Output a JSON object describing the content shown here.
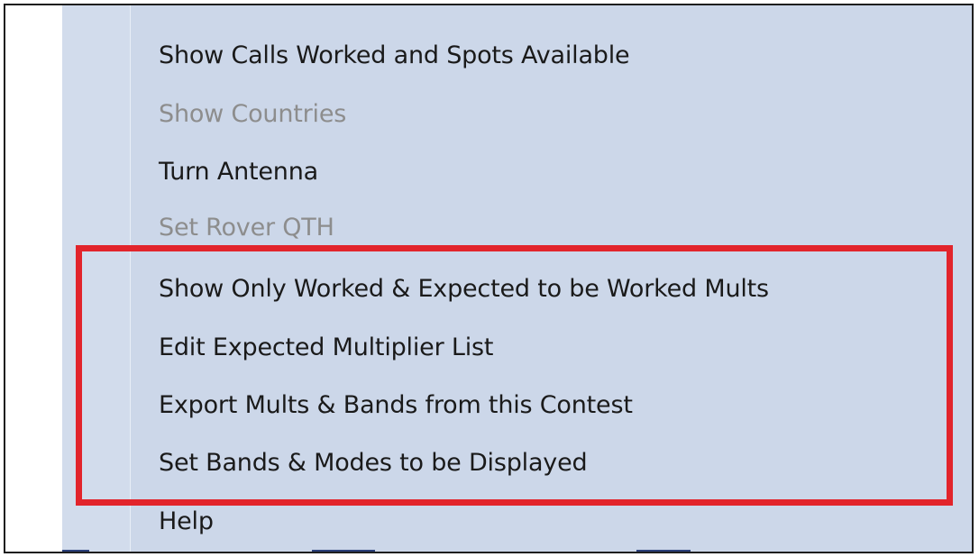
{
  "context_menu": {
    "items": [
      {
        "label": "Show Calls Worked and Spots Available",
        "enabled": true
      },
      {
        "label": "Show Countries",
        "enabled": false
      },
      {
        "label": "Turn Antenna",
        "enabled": true
      },
      {
        "label": "Set Rover QTH",
        "enabled": false
      },
      {
        "label": "Show Only Worked & Expected to be Worked Mults",
        "enabled": true
      },
      {
        "label": "Edit Expected Multiplier List",
        "enabled": true
      },
      {
        "label": "Export Mults & Bands from this Contest",
        "enabled": true
      },
      {
        "label": "Set Bands & Modes to be Displayed",
        "enabled": true
      },
      {
        "label": "Help",
        "enabled": true
      }
    ]
  },
  "colors": {
    "menu_background": "#ccd7e9",
    "highlight_border": "#e2242b",
    "disabled_text": "#8d8d8d"
  }
}
